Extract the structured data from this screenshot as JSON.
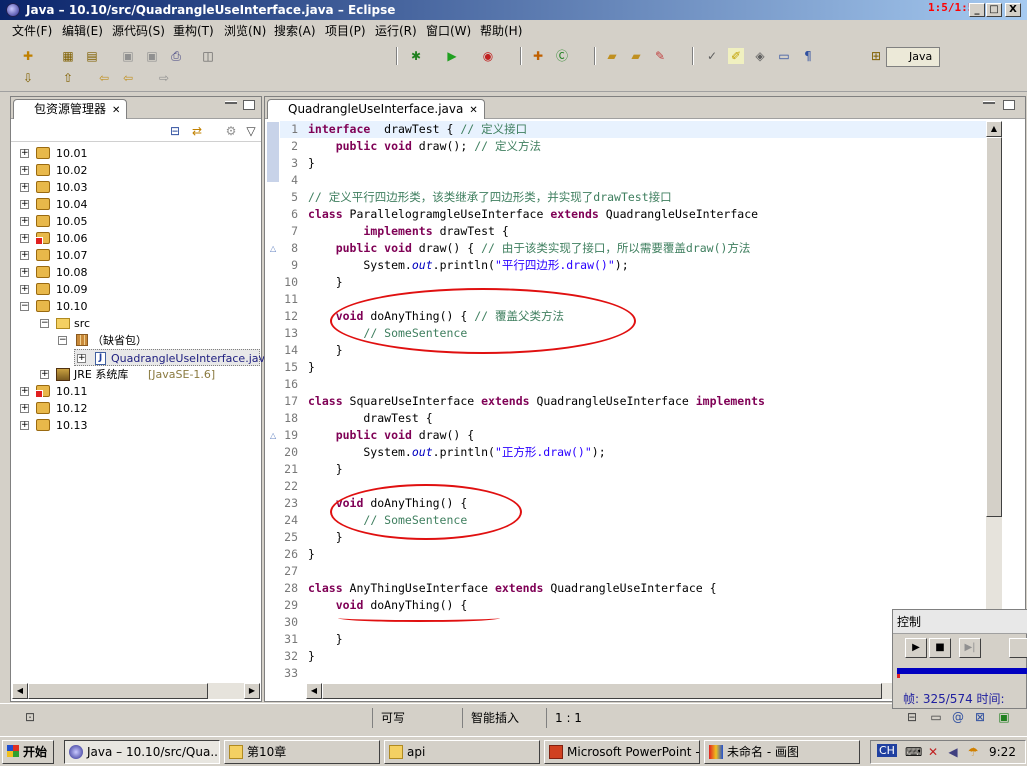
{
  "window": {
    "title": "Java – 10.10/src/QuadrangleUseInterface.java – Eclipse",
    "recorder_time": "1:5/1:54",
    "min": "_",
    "max": "□",
    "close": "X"
  },
  "menu": [
    "文件(F)",
    "编辑(E)",
    "源代码(S)",
    "重构(T)",
    "浏览(N)",
    "搜索(A)",
    "项目(P)",
    "运行(R)",
    "窗口(W)",
    "帮助(H)"
  ],
  "perspective": {
    "label": "Java"
  },
  "explorer": {
    "title": "包资源管理器",
    "close": "✕",
    "items": [
      {
        "label": "10.01"
      },
      {
        "label": "10.02"
      },
      {
        "label": "10.03"
      },
      {
        "label": "10.04"
      },
      {
        "label": "10.05"
      },
      {
        "label": "10.06"
      },
      {
        "label": "10.07"
      },
      {
        "label": "10.08"
      },
      {
        "label": "10.09"
      },
      {
        "label": "10.10"
      }
    ],
    "src": "src",
    "default_pkg": "（缺省包）",
    "file": "QuadrangleUseInterface.java",
    "jre": "JRE 系统库",
    "jre_version": "[JavaSE-1.6]",
    "items_after": [
      {
        "label": "10.11"
      },
      {
        "label": "10.12"
      },
      {
        "label": "10.13"
      }
    ]
  },
  "editor": {
    "tab": "QuadrangleUseInterface.java",
    "tab_close": "✕",
    "lines": [
      {
        "n": "1",
        "parts": [
          [
            "kw",
            "interface"
          ],
          [
            "",
            "  drawTest { "
          ],
          [
            "cm",
            "// 定义接口"
          ]
        ]
      },
      {
        "n": "2",
        "parts": [
          [
            "",
            "    "
          ],
          [
            "kw",
            "public void"
          ],
          [
            "",
            " draw(); "
          ],
          [
            "cm",
            "// 定义方法"
          ]
        ]
      },
      {
        "n": "3",
        "parts": [
          [
            "",
            "}"
          ]
        ]
      },
      {
        "n": "4",
        "parts": [
          [
            "",
            ""
          ]
        ]
      },
      {
        "n": "5",
        "parts": [
          [
            "cm",
            "// 定义平行四边形类，该类继承了四边形类，并实现了drawTest接口"
          ]
        ]
      },
      {
        "n": "6",
        "parts": [
          [
            "kw",
            "class"
          ],
          [
            "",
            " ParallelogramgleUseInterface "
          ],
          [
            "kw",
            "extends"
          ],
          [
            "",
            " QuadrangleUseInterface"
          ]
        ]
      },
      {
        "n": "7",
        "parts": [
          [
            "",
            "        "
          ],
          [
            "kw",
            "implements"
          ],
          [
            "",
            " drawTest {"
          ]
        ]
      },
      {
        "n": "8",
        "parts": [
          [
            "",
            "    "
          ],
          [
            "kw",
            "public void"
          ],
          [
            "",
            " draw() { "
          ],
          [
            "cm",
            "// 由于该类实现了接口，所以需要覆盖draw()方法"
          ]
        ]
      },
      {
        "n": "9",
        "parts": [
          [
            "",
            "        System."
          ],
          [
            "it",
            "out"
          ],
          [
            "",
            ".println("
          ],
          [
            "st",
            "\"平行四边形.draw()\""
          ],
          [
            "",
            ");"
          ]
        ]
      },
      {
        "n": "10",
        "parts": [
          [
            "",
            "    }"
          ]
        ]
      },
      {
        "n": "11",
        "parts": [
          [
            "",
            ""
          ]
        ]
      },
      {
        "n": "12",
        "parts": [
          [
            "",
            "    "
          ],
          [
            "kw",
            "void"
          ],
          [
            "",
            " doAnyThing() { "
          ],
          [
            "cm",
            "// 覆盖父类方法"
          ]
        ]
      },
      {
        "n": "13",
        "parts": [
          [
            "",
            "        "
          ],
          [
            "cm",
            "// SomeSentence"
          ]
        ]
      },
      {
        "n": "14",
        "parts": [
          [
            "",
            "    }"
          ]
        ]
      },
      {
        "n": "15",
        "parts": [
          [
            "",
            "}"
          ]
        ]
      },
      {
        "n": "16",
        "parts": [
          [
            "",
            ""
          ]
        ]
      },
      {
        "n": "17",
        "parts": [
          [
            "kw",
            "class"
          ],
          [
            "",
            " SquareUseInterface "
          ],
          [
            "kw",
            "extends"
          ],
          [
            "",
            " QuadrangleUseInterface "
          ],
          [
            "kw",
            "implements"
          ]
        ]
      },
      {
        "n": "18",
        "parts": [
          [
            "",
            "        drawTest {"
          ]
        ]
      },
      {
        "n": "19",
        "parts": [
          [
            "",
            "    "
          ],
          [
            "kw",
            "public void"
          ],
          [
            "",
            " draw() {"
          ]
        ]
      },
      {
        "n": "20",
        "parts": [
          [
            "",
            "        System."
          ],
          [
            "it",
            "out"
          ],
          [
            "",
            ".println("
          ],
          [
            "st",
            "\"正方形.draw()\""
          ],
          [
            "",
            ");"
          ]
        ]
      },
      {
        "n": "21",
        "parts": [
          [
            "",
            "    }"
          ]
        ]
      },
      {
        "n": "22",
        "parts": [
          [
            "",
            ""
          ]
        ]
      },
      {
        "n": "23",
        "parts": [
          [
            "",
            "    "
          ],
          [
            "kw",
            "void"
          ],
          [
            "",
            " doAnyThing() {"
          ]
        ]
      },
      {
        "n": "24",
        "parts": [
          [
            "",
            "        "
          ],
          [
            "cm",
            "// SomeSentence"
          ]
        ]
      },
      {
        "n": "25",
        "parts": [
          [
            "",
            "    }"
          ]
        ]
      },
      {
        "n": "26",
        "parts": [
          [
            "",
            "}"
          ]
        ]
      },
      {
        "n": "27",
        "parts": [
          [
            "",
            ""
          ]
        ]
      },
      {
        "n": "28",
        "parts": [
          [
            "kw",
            "class"
          ],
          [
            "",
            " AnyThingUseInterface "
          ],
          [
            "kw",
            "extends"
          ],
          [
            "",
            " QuadrangleUseInterface {"
          ]
        ]
      },
      {
        "n": "29",
        "parts": [
          [
            "",
            "    "
          ],
          [
            "kw",
            "void"
          ],
          [
            "",
            " doAnyThing() {"
          ]
        ]
      },
      {
        "n": "30",
        "parts": [
          [
            "",
            ""
          ]
        ]
      },
      {
        "n": "31",
        "parts": [
          [
            "",
            "    }"
          ]
        ]
      },
      {
        "n": "32",
        "parts": [
          [
            "",
            "}"
          ]
        ]
      },
      {
        "n": "33",
        "parts": [
          [
            "",
            ""
          ]
        ]
      }
    ]
  },
  "status": {
    "writable": "可写",
    "insert_mode": "智能插入",
    "position": "1 : 1"
  },
  "control": {
    "title": "控制",
    "frames": "帧: 325/574 时间:"
  },
  "taskbar": {
    "start": "开始",
    "tasks": [
      {
        "label": "Java – 10.10/src/Qua..."
      },
      {
        "label": "第10章"
      },
      {
        "label": "api"
      },
      {
        "label": "Microsoft PowerPoint - [..."
      },
      {
        "label": "未命名 - 画图"
      }
    ],
    "ime": "CH",
    "clock": "9:22"
  }
}
